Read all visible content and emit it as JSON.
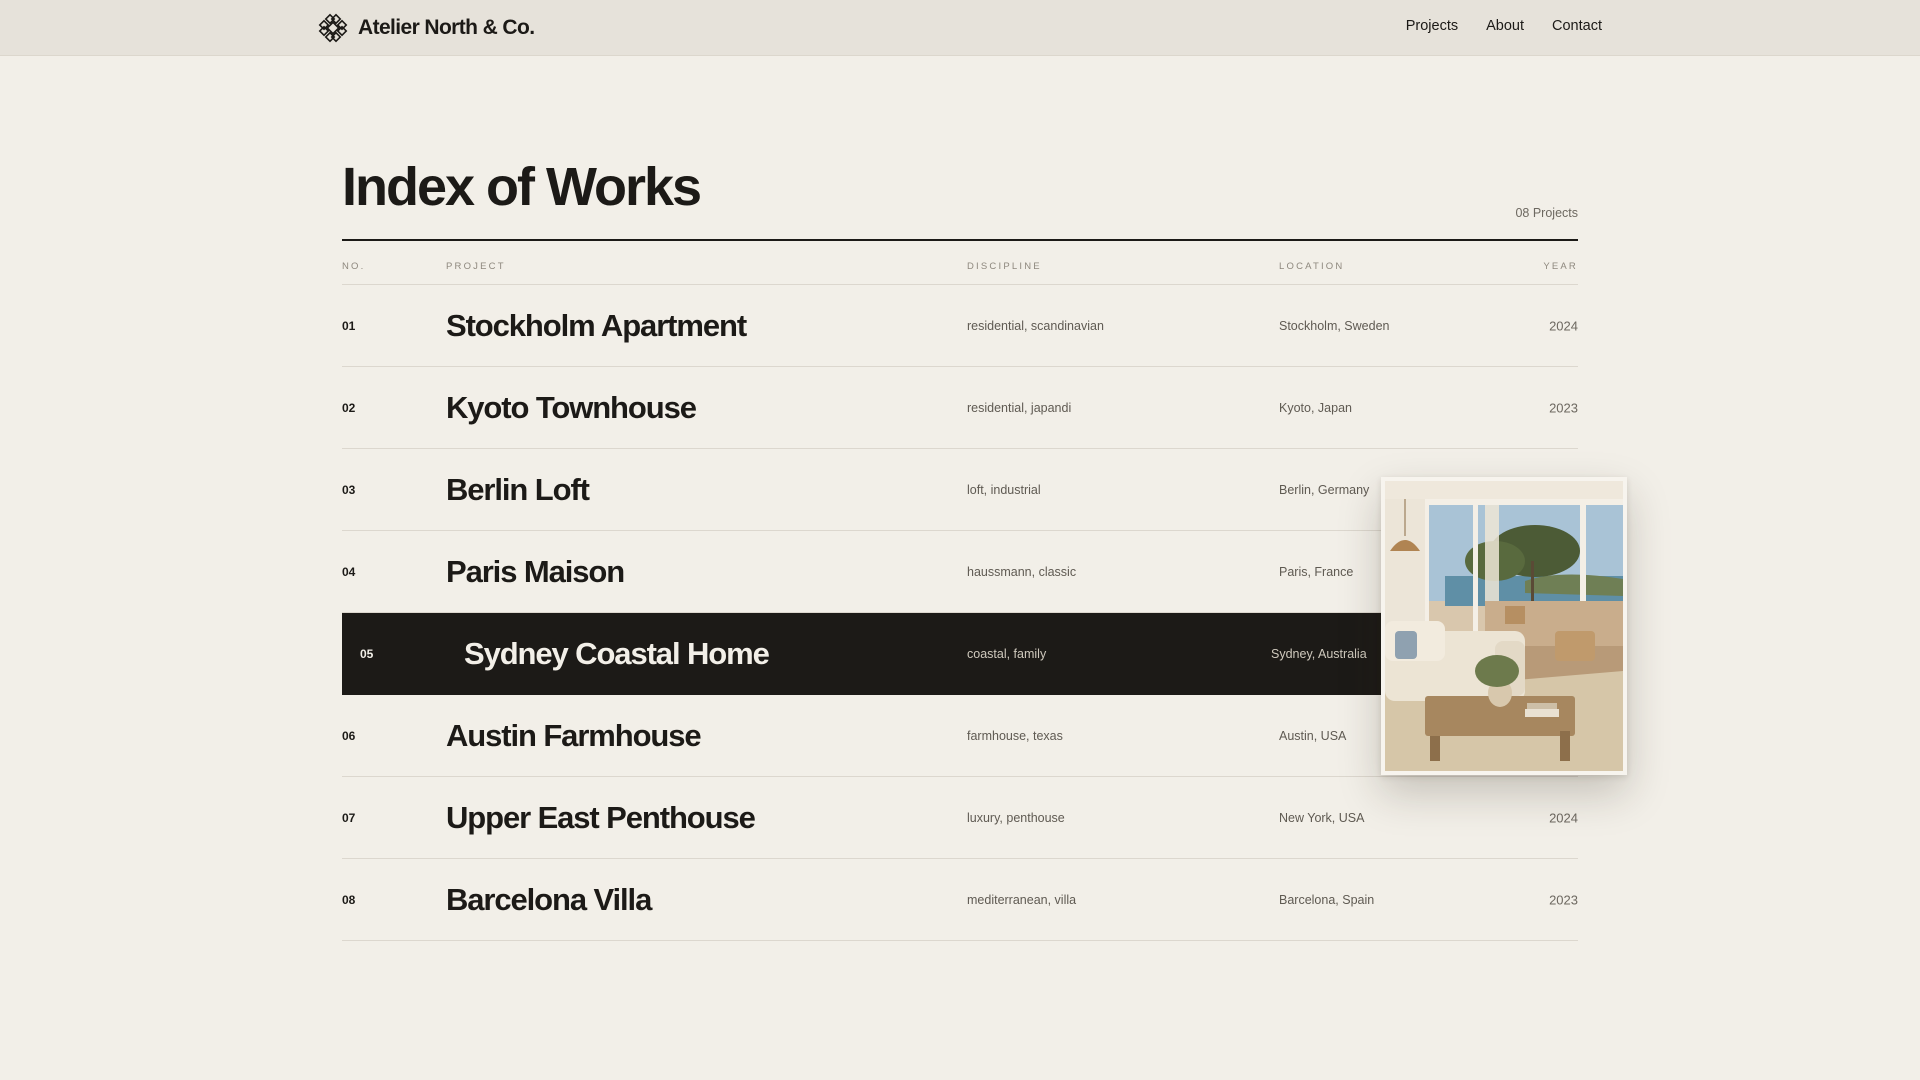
{
  "header": {
    "brand_name": "Atelier North & Co.",
    "logo_icon": "knot-ornament-icon",
    "nav": [
      "Projects",
      "About",
      "Contact"
    ]
  },
  "index": {
    "title": "Index of Works",
    "count_label": "08 Projects",
    "columns": {
      "no": "NO.",
      "project": "PROJECT",
      "discipline": "DISCIPLINE",
      "location": "LOCATION",
      "year": "YEAR"
    },
    "rows": [
      {
        "no": "01",
        "project": "Stockholm Apartment",
        "discipline": "residential, scandinavian",
        "location": "Stockholm, Sweden",
        "year": "2024"
      },
      {
        "no": "02",
        "project": "Kyoto Townhouse",
        "discipline": "residential, japandi",
        "location": "Kyoto, Japan",
        "year": "2023"
      },
      {
        "no": "03",
        "project": "Berlin Loft",
        "discipline": "loft, industrial",
        "location": "Berlin, Germany",
        "year": ""
      },
      {
        "no": "04",
        "project": "Paris Maison",
        "discipline": "haussmann, classic",
        "location": "Paris, France",
        "year": ""
      },
      {
        "no": "05",
        "project": "Sydney Coastal Home",
        "discipline": "coastal, family",
        "location": "Sydney, Australia",
        "year": ""
      },
      {
        "no": "06",
        "project": "Austin Farmhouse",
        "discipline": "farmhouse, texas",
        "location": "Austin, USA",
        "year": ""
      },
      {
        "no": "07",
        "project": "Upper East Penthouse",
        "discipline": "luxury, penthouse",
        "location": "New York, USA",
        "year": "2024"
      },
      {
        "no": "08",
        "project": "Barcelona Villa",
        "discipline": "mediterranean, villa",
        "location": "Barcelona, Spain",
        "year": "2023"
      }
    ],
    "active_row": "05"
  },
  "preview": {
    "image": "coastal-living-room-photo"
  },
  "colors": {
    "background": "#f2efe8",
    "header_bg": "#e6e2da",
    "ink": "#1c1a17",
    "muted": "#5f5a52",
    "active_row_bg": "#1c1a17"
  }
}
